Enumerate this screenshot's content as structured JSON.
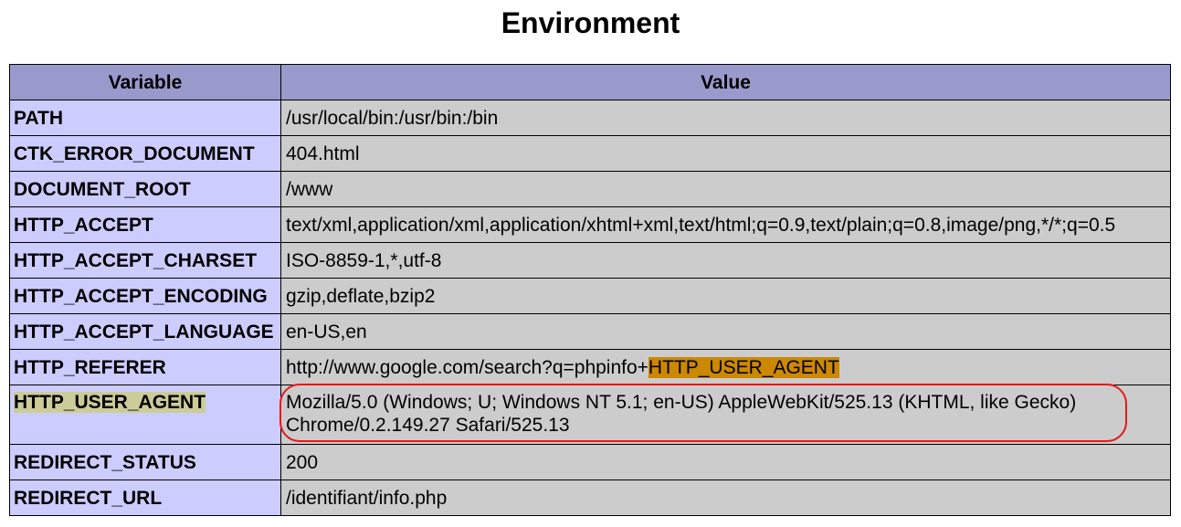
{
  "page": {
    "title": "Environment"
  },
  "table": {
    "headers": {
      "variable": "Variable",
      "value": "Value"
    },
    "rows": [
      {
        "variable": "PATH",
        "value": "/usr/local/bin:/usr/bin:/bin"
      },
      {
        "variable": "CTK_ERROR_DOCUMENT",
        "value": "404.html"
      },
      {
        "variable": "DOCUMENT_ROOT",
        "value": "/www"
      },
      {
        "variable": "HTTP_ACCEPT",
        "value": "text/xml,application/xml,application/xhtml+xml,text/html;q=0.9,text/plain;q=0.8,image/png,*/*;q=0.5"
      },
      {
        "variable": "HTTP_ACCEPT_CHARSET",
        "value": "ISO-8859-1,*,utf-8"
      },
      {
        "variable": "HTTP_ACCEPT_ENCODING",
        "value": "gzip,deflate,bzip2"
      },
      {
        "variable": "HTTP_ACCEPT_LANGUAGE",
        "value": "en-US,en"
      },
      {
        "variable": "HTTP_REFERER",
        "value_prefix": "http://www.google.com/search?q=phpinfo+",
        "value_highlight": "HTTP_USER_AGENT"
      },
      {
        "variable": "HTTP_USER_AGENT",
        "value_line1": "Mozilla/5.0 (Windows; U; Windows NT 5.1; en-US) AppleWebKit/525.13 (KHTML, like Gecko)",
        "value_line2": "Chrome/0.2.149.27 Safari/525.13"
      },
      {
        "variable": "REDIRECT_STATUS",
        "value": "200"
      },
      {
        "variable": "REDIRECT_URL",
        "value": "/identifiant/info.php"
      }
    ]
  },
  "colors": {
    "header_bg": "#9999cc",
    "variable_bg": "#ccccff",
    "value_bg": "#cccccc",
    "variable_highlight": "#cccc99",
    "search_highlight": "#cc8800",
    "annotation_circle": "#e31a1a"
  }
}
